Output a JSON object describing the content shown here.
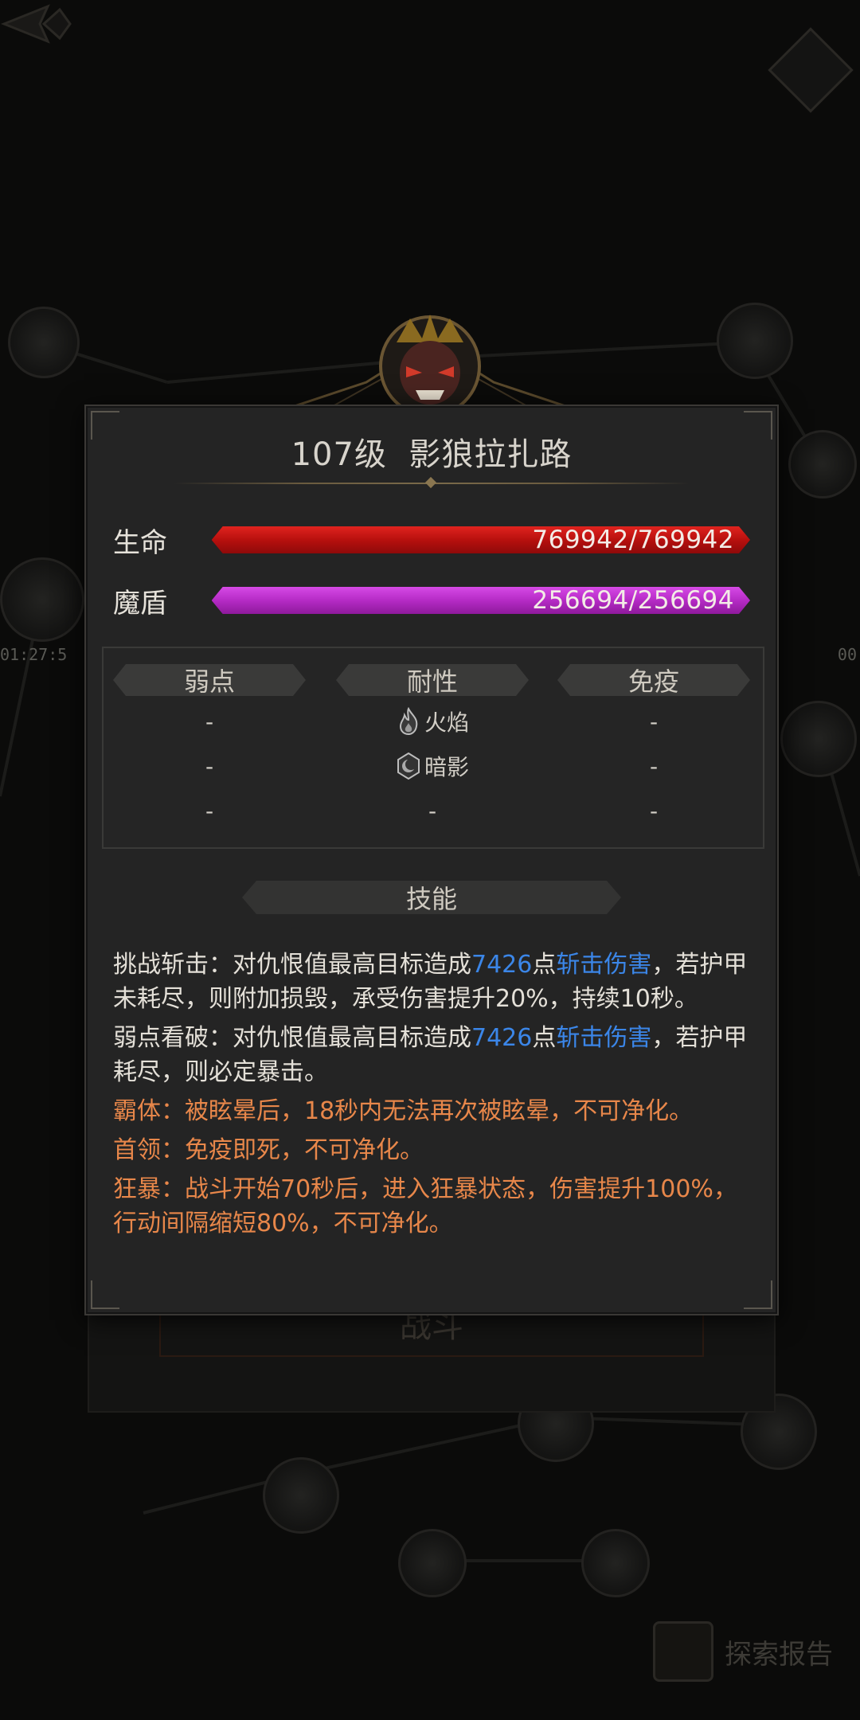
{
  "background": {
    "timer_left": "01:27:5",
    "timer_right": "00",
    "battle_button_label": "战斗",
    "explore_report_label": "探索报告"
  },
  "boss": {
    "level_label": "107级",
    "name": "影狼拉扎路"
  },
  "stats": {
    "hp": {
      "label": "生命",
      "current": 769942,
      "max": 769942,
      "text": "769942/769942",
      "fill_fraction": 1.0,
      "color": "#c8141a"
    },
    "shield": {
      "label": "魔盾",
      "current": 256694,
      "max": 256694,
      "text": "256694/256694",
      "fill_fraction": 1.0,
      "color": "#b52bc5"
    }
  },
  "resist_table": {
    "headers": [
      "弱点",
      "耐性",
      "免疫"
    ],
    "rows": [
      {
        "weak": "-",
        "resist": "火焰",
        "resist_icon": "fire-icon",
        "immune": "-"
      },
      {
        "weak": "-",
        "resist": "暗影",
        "resist_icon": "shadow-icon",
        "immune": "-"
      },
      {
        "weak": "-",
        "resist": "-",
        "resist_icon": "",
        "immune": "-"
      }
    ]
  },
  "skills": {
    "header": "技能",
    "items": [
      {
        "color": "white",
        "prefix": "挑战斩击：对仇恨值最高目标造成",
        "damage": "7426",
        "unit": "点",
        "damage_type": "斩击伤害",
        "suffix": "，若护甲未耗尽，则附加损毁，承受伤害提升20%，持续10秒。"
      },
      {
        "color": "white",
        "prefix": "弱点看破：对仇恨值最高目标造成",
        "damage": "7426",
        "unit": "点",
        "damage_type": "斩击伤害",
        "suffix": "，若护甲耗尽，则必定暴击。"
      },
      {
        "color": "orange",
        "text": "霸体：被眩晕后，18秒内无法再次被眩晕，不可净化。"
      },
      {
        "color": "orange",
        "text": "首领：免疫即死，不可净化。"
      },
      {
        "color": "orange",
        "text": "狂暴：战斗开始70秒后，进入狂暴状态，伤害提升100%，行动间隔缩短80%，不可净化。"
      }
    ]
  },
  "colors": {
    "skill_orange": "#e8874a",
    "damage_blue": "#3b86e8",
    "panel_bg": "#242424"
  }
}
